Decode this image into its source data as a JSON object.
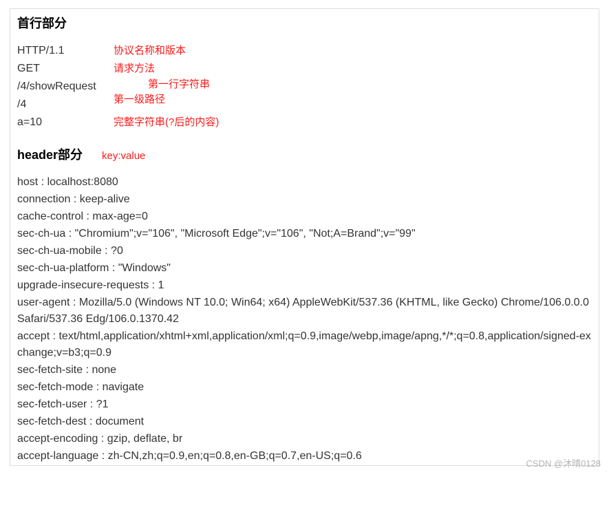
{
  "section1": {
    "title": "首行部分",
    "rows": [
      {
        "value": "HTTP/1.1",
        "annot": "协议名称和版本"
      },
      {
        "value": "GET",
        "annot": "请求方法"
      },
      {
        "value": "/4/showRequest",
        "annot": ""
      },
      {
        "value": "/4",
        "annot": ""
      },
      {
        "value": "a=10",
        "annot": "完整字符串(?后的内容)"
      }
    ],
    "floating": {
      "line1": "第一行字符串",
      "level1": "第一级路径"
    }
  },
  "section2": {
    "title": "header部分",
    "annot": "key:value",
    "headers": [
      "host : localhost:8080",
      "connection : keep-alive",
      "cache-control : max-age=0",
      "sec-ch-ua : \"Chromium\";v=\"106\", \"Microsoft Edge\";v=\"106\", \"Not;A=Brand\";v=\"99\"",
      "sec-ch-ua-mobile : ?0",
      "sec-ch-ua-platform : \"Windows\"",
      "upgrade-insecure-requests : 1",
      "user-agent : Mozilla/5.0 (Windows NT 10.0; Win64; x64) AppleWebKit/537.36 (KHTML, like Gecko) Chrome/106.0.0.0 Safari/537.36 Edg/106.0.1370.42",
      "accept : text/html,application/xhtml+xml,application/xml;q=0.9,image/webp,image/apng,*/*;q=0.8,application/signed-exchange;v=b3;q=0.9",
      "sec-fetch-site : none",
      "sec-fetch-mode : navigate",
      "sec-fetch-user : ?1",
      "sec-fetch-dest : document",
      "accept-encoding : gzip, deflate, br",
      "accept-language : zh-CN,zh;q=0.9,en;q=0.8,en-GB;q=0.7,en-US;q=0.6"
    ]
  },
  "watermark": "CSDN @沐晴0128"
}
